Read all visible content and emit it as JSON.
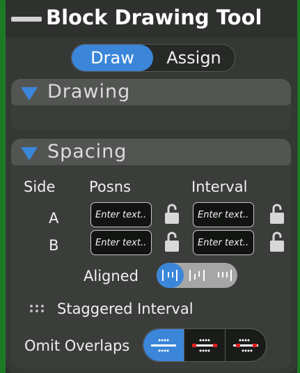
{
  "window": {
    "title": "Block Drawing Tool"
  },
  "mode_toggle": {
    "options": [
      "Draw",
      "Assign"
    ],
    "selected": "Draw"
  },
  "sections": {
    "drawing": {
      "title": "Drawing",
      "expanded": true
    },
    "spacing": {
      "title": "Spacing",
      "expanded": true
    }
  },
  "spacing": {
    "headers": {
      "side": "Side",
      "posns": "Posns",
      "interval": "Interval"
    },
    "rows": [
      {
        "side": "A",
        "posns_placeholder": "Enter text...",
        "interval_placeholder": "Enter text..."
      },
      {
        "side": "B",
        "posns_placeholder": "Enter text...",
        "interval_placeholder": "Enter text..."
      }
    ],
    "aligned": {
      "label": "Aligned",
      "selected_index": 0,
      "option_icons": [
        "aligned-ticks-icon",
        "staggered-ticks-icon",
        "right-ticks-icon"
      ]
    },
    "staggered_interval": {
      "label": "Staggered Interval",
      "icon": "grip-dots-icon"
    },
    "omit_overlaps": {
      "label": "Omit Overlaps",
      "selected_index": 0,
      "option_icons": [
        "omit-none-icon",
        "omit-overlap-icon",
        "omit-both-icon"
      ]
    }
  },
  "colors": {
    "accent": "#3b86d9",
    "overlap_marker": "#e02020",
    "panel": "#363836",
    "header": "#535553"
  }
}
